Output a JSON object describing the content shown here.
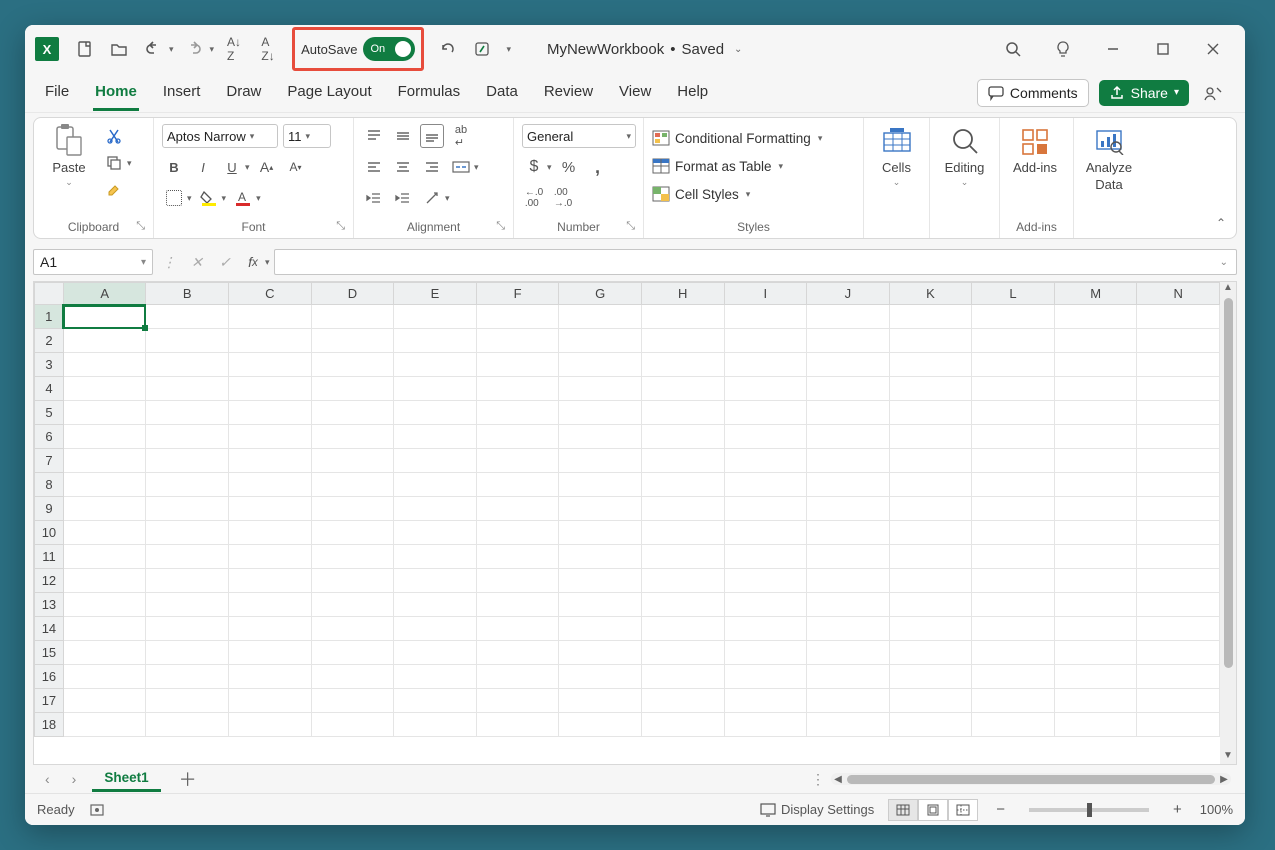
{
  "titlebar": {
    "autosave_label": "AutoSave",
    "autosave_state": "On",
    "workbook_name": "MyNewWorkbook",
    "workbook_status": "Saved"
  },
  "tabs": {
    "items": [
      "File",
      "Home",
      "Insert",
      "Draw",
      "Page Layout",
      "Formulas",
      "Data",
      "Review",
      "View",
      "Help"
    ],
    "active_index": 1,
    "comments_label": "Comments",
    "share_label": "Share"
  },
  "ribbon": {
    "clipboard": {
      "label": "Clipboard",
      "paste": "Paste"
    },
    "font": {
      "label": "Font",
      "name": "Aptos Narrow",
      "size": "11"
    },
    "alignment": {
      "label": "Alignment"
    },
    "number": {
      "label": "Number",
      "format": "General"
    },
    "styles": {
      "label": "Styles",
      "conditional": "Conditional Formatting",
      "format_table": "Format as Table",
      "cell_styles": "Cell Styles"
    },
    "cells": {
      "label": "Cells"
    },
    "editing": {
      "label": "Editing"
    },
    "addins": {
      "label": "Add-ins",
      "button": "Add-ins"
    },
    "analyze": {
      "line1": "Analyze",
      "line2": "Data"
    }
  },
  "formula_bar": {
    "cell_ref": "A1",
    "formula": ""
  },
  "grid": {
    "columns": [
      "A",
      "B",
      "C",
      "D",
      "E",
      "F",
      "G",
      "H",
      "I",
      "J",
      "K",
      "L",
      "M",
      "N"
    ],
    "rows": [
      1,
      2,
      3,
      4,
      5,
      6,
      7,
      8,
      9,
      10,
      11,
      12,
      13,
      14,
      15,
      16,
      17,
      18
    ],
    "active_cell": "A1"
  },
  "sheet_tabs": {
    "active": "Sheet1"
  },
  "status": {
    "ready": "Ready",
    "display_settings": "Display Settings",
    "zoom": "100%"
  }
}
